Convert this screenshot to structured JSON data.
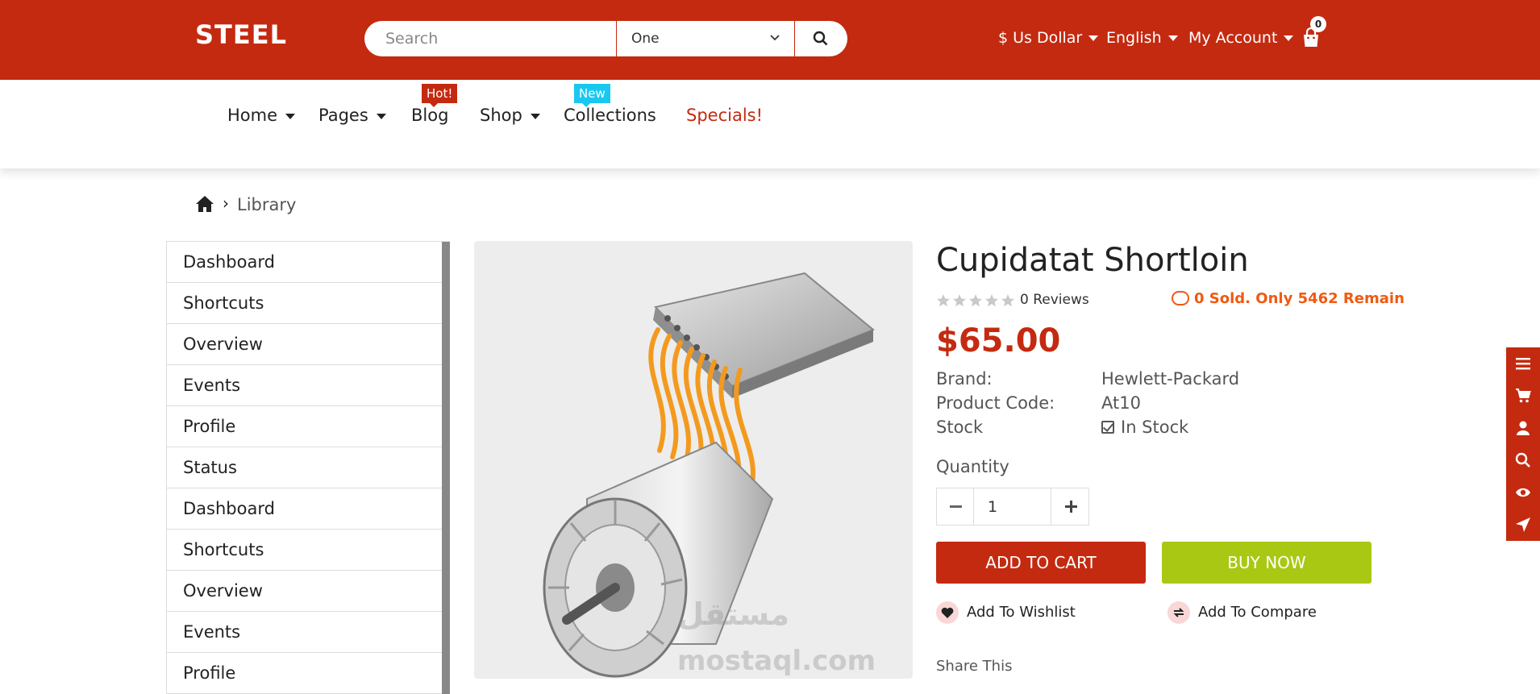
{
  "header": {
    "logo": "STEEL",
    "search_placeholder": "Search",
    "category_select": "One",
    "currency": "$ Us Dollar",
    "language": "English",
    "account": "My Account",
    "cart_count": "0"
  },
  "nav": {
    "items": [
      {
        "label": "Home",
        "has_dropdown": true
      },
      {
        "label": "Pages",
        "has_dropdown": true
      },
      {
        "label": "Blog",
        "badge": "Hot!"
      },
      {
        "label": "Shop",
        "has_dropdown": true
      },
      {
        "label": "Collections",
        "badge": "New"
      },
      {
        "label": "Specials!"
      }
    ]
  },
  "breadcrumb": {
    "current": "Library"
  },
  "sidebar": {
    "items": [
      "Dashboard",
      "Shortcuts",
      "Overview",
      "Events",
      "Profile",
      "Status",
      "Dashboard",
      "Shortcuts",
      "Overview",
      "Events",
      "Profile"
    ]
  },
  "product": {
    "title": "Cupidatat Shortloin",
    "reviews": "0 Reviews",
    "rating": 0,
    "sold": "0 Sold. Only 5462 Remain",
    "price": "$65.00",
    "brand_label": "Brand:",
    "brand": "Hewlett-Packard",
    "code_label": "Product Code:",
    "code": "At10",
    "stock_label": "Stock",
    "stock": "In Stock",
    "quantity_label": "Quantity",
    "quantity": "1",
    "add_to_cart": "ADD TO CART",
    "buy_now": "BUY NOW",
    "wishlist": "Add To Wishlist",
    "compare": "Add To Compare",
    "share": "Share This"
  },
  "watermark": {
    "arabic": "مستقل",
    "latin": "mostaql.com"
  },
  "colors": {
    "brand": "#c42a10",
    "buy": "#a9c814",
    "badge_new": "#19c8f0",
    "sold": "#f05a12"
  }
}
